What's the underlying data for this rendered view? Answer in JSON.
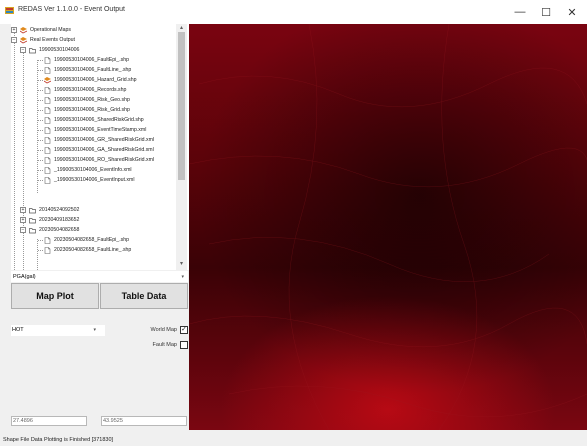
{
  "window": {
    "title": "REDAS Ver 1.1.0.0 - Event Output",
    "minimize": "—",
    "maximize": "☐",
    "close": "✕"
  },
  "tree": {
    "root_nodes": [
      {
        "label": "Operational Maps",
        "icon": "folder-layers-icon"
      },
      {
        "label": "Real Events Output",
        "icon": "folder-layers-icon"
      }
    ],
    "event1": {
      "label": "19900530104006",
      "files": [
        {
          "label": "19900530104006_FaultEpi_.shp",
          "icon": "file-icon"
        },
        {
          "label": "19900530104006_FaultLine_.shp",
          "icon": "file-icon"
        },
        {
          "label": "19900530104006_Hazard_Grid.shp",
          "icon": "layer-icon"
        },
        {
          "label": "19900530104006_Records.shp",
          "icon": "file-icon"
        },
        {
          "label": "19900530104006_Risk_Geo.shp",
          "icon": "file-icon"
        },
        {
          "label": "19900530104006_Risk_Grid.shp",
          "icon": "file-icon"
        },
        {
          "label": "19900530104006_SharedRiskGrid.shp",
          "icon": "file-icon"
        },
        {
          "label": "19900530104006_EventTimeStamp.xml",
          "icon": "file-icon"
        },
        {
          "label": "19900530104006_GR_SharedRiskGrid.xml",
          "icon": "file-icon"
        },
        {
          "label": "19900530104006_GA_SharedRiskGrid.xml",
          "icon": "file-icon"
        },
        {
          "label": "19900530104006_RO_SharedRiskGrid.xml",
          "icon": "file-icon"
        },
        {
          "label": "_19900530104006_EventInfo.xml",
          "icon": "file-icon"
        },
        {
          "label": "_19900530104006_EventInput.xml",
          "icon": "file-icon"
        }
      ]
    },
    "event2": {
      "label": "20140524092502"
    },
    "event3": {
      "label": "20230409183652"
    },
    "event4": {
      "label": "20230504082658",
      "files": [
        {
          "label": "20230504082658_FaultEpi_.shp",
          "icon": "file-icon"
        },
        {
          "label": "20230504082658_FaultLine_.shp",
          "icon": "file-icon"
        }
      ]
    },
    "expand_plus": "+",
    "expand_minus": "−"
  },
  "controls": {
    "parameter_select": "PGA(gal)",
    "map_plot": "Map Plot",
    "table_data": "Table Data",
    "colormap_select": "HOT",
    "world_map_label": "World Map",
    "world_map_checked": true,
    "fault_map_label": "Fault Map",
    "fault_map_checked": false,
    "check_mark": "✓",
    "dropdown_arrow": "▾",
    "coord_x": "27.4896",
    "coord_y": "43.9525"
  },
  "scroll": {
    "up": "▴",
    "down": "▾"
  },
  "status": "Shape File Data Plotting is Finished [371830]",
  "colors": {
    "map_dark": "#3a0206",
    "map_red": "#8a0512",
    "accent": "#c81e1e"
  }
}
